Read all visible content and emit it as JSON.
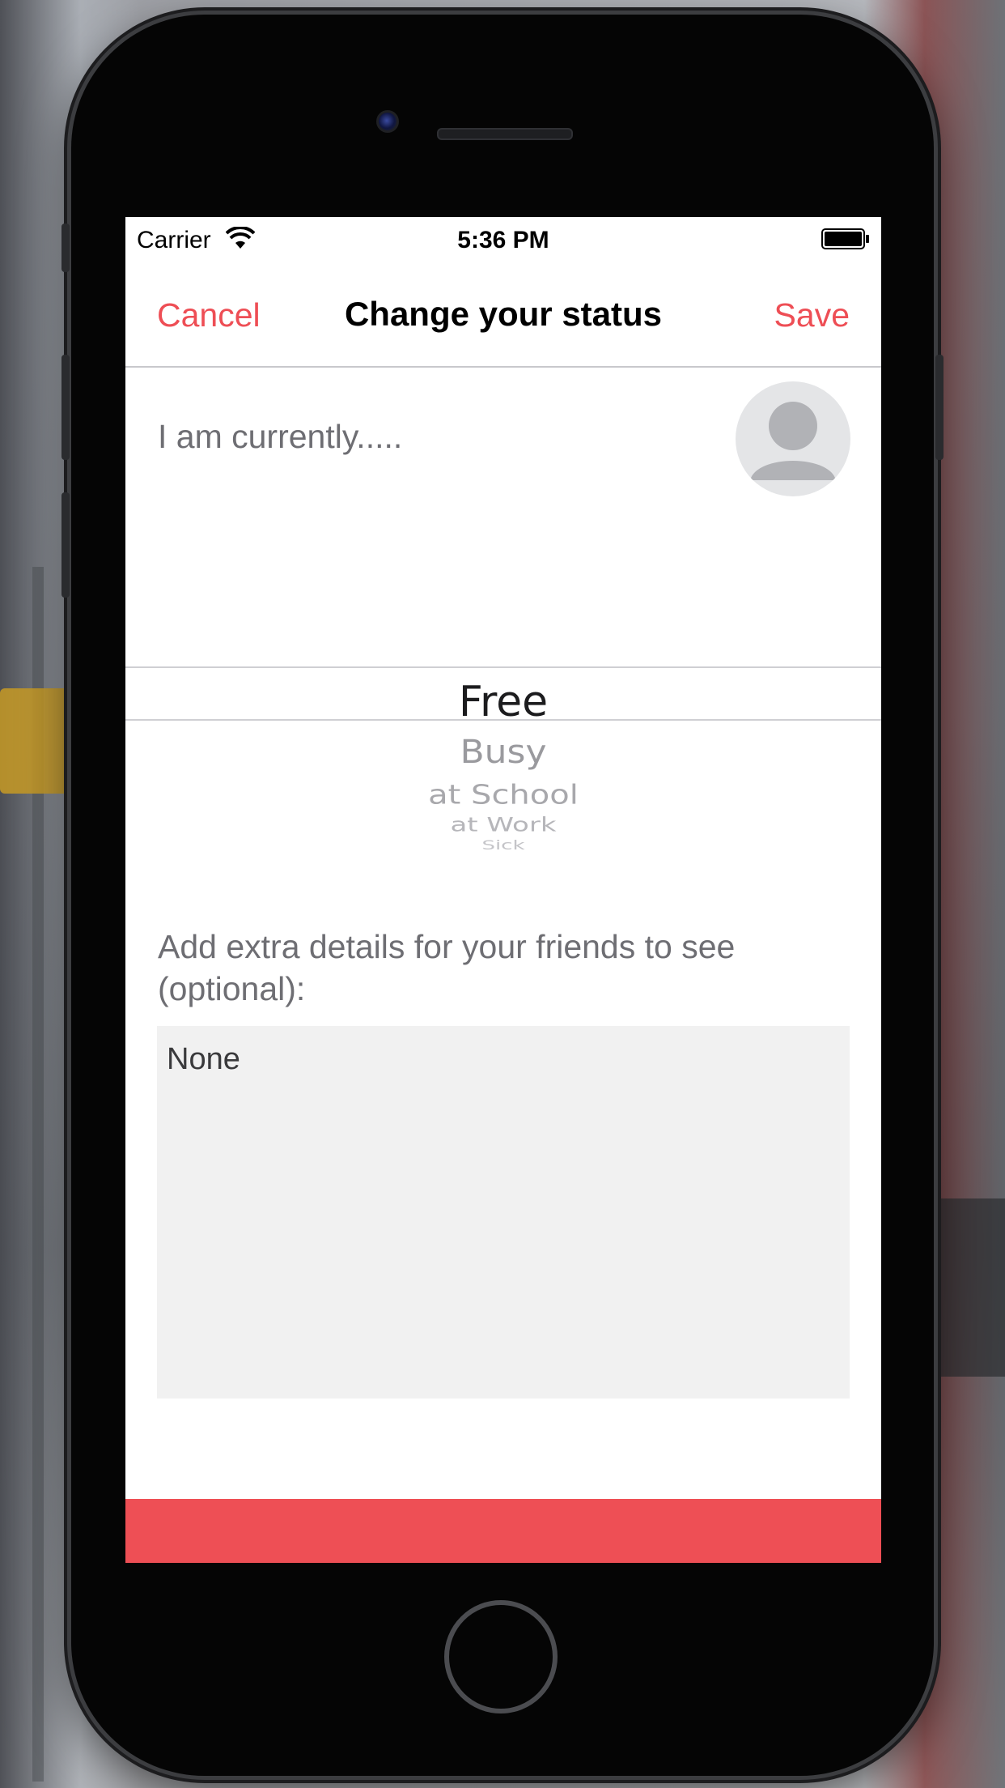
{
  "status_bar": {
    "carrier": "Carrier",
    "time": "5:36 PM",
    "wifi_icon": "wifi-icon",
    "battery_icon": "battery-icon"
  },
  "nav": {
    "cancel_label": "Cancel",
    "title": "Change your status",
    "save_label": "Save"
  },
  "status_prompt": "I am currently.....",
  "avatar_icon": "user-avatar-icon",
  "status_picker": {
    "selected": "Free",
    "options": [
      "Free",
      "Busy",
      "at School",
      "at Work",
      "Sick"
    ]
  },
  "details": {
    "label": "Add extra details for your friends to see (optional):",
    "value": "None"
  },
  "colors": {
    "accent": "#ee4e55",
    "bottom_bar": "#ee4f55",
    "details_bg": "#f1f1f1",
    "secondary_text": "#6e6e73"
  }
}
